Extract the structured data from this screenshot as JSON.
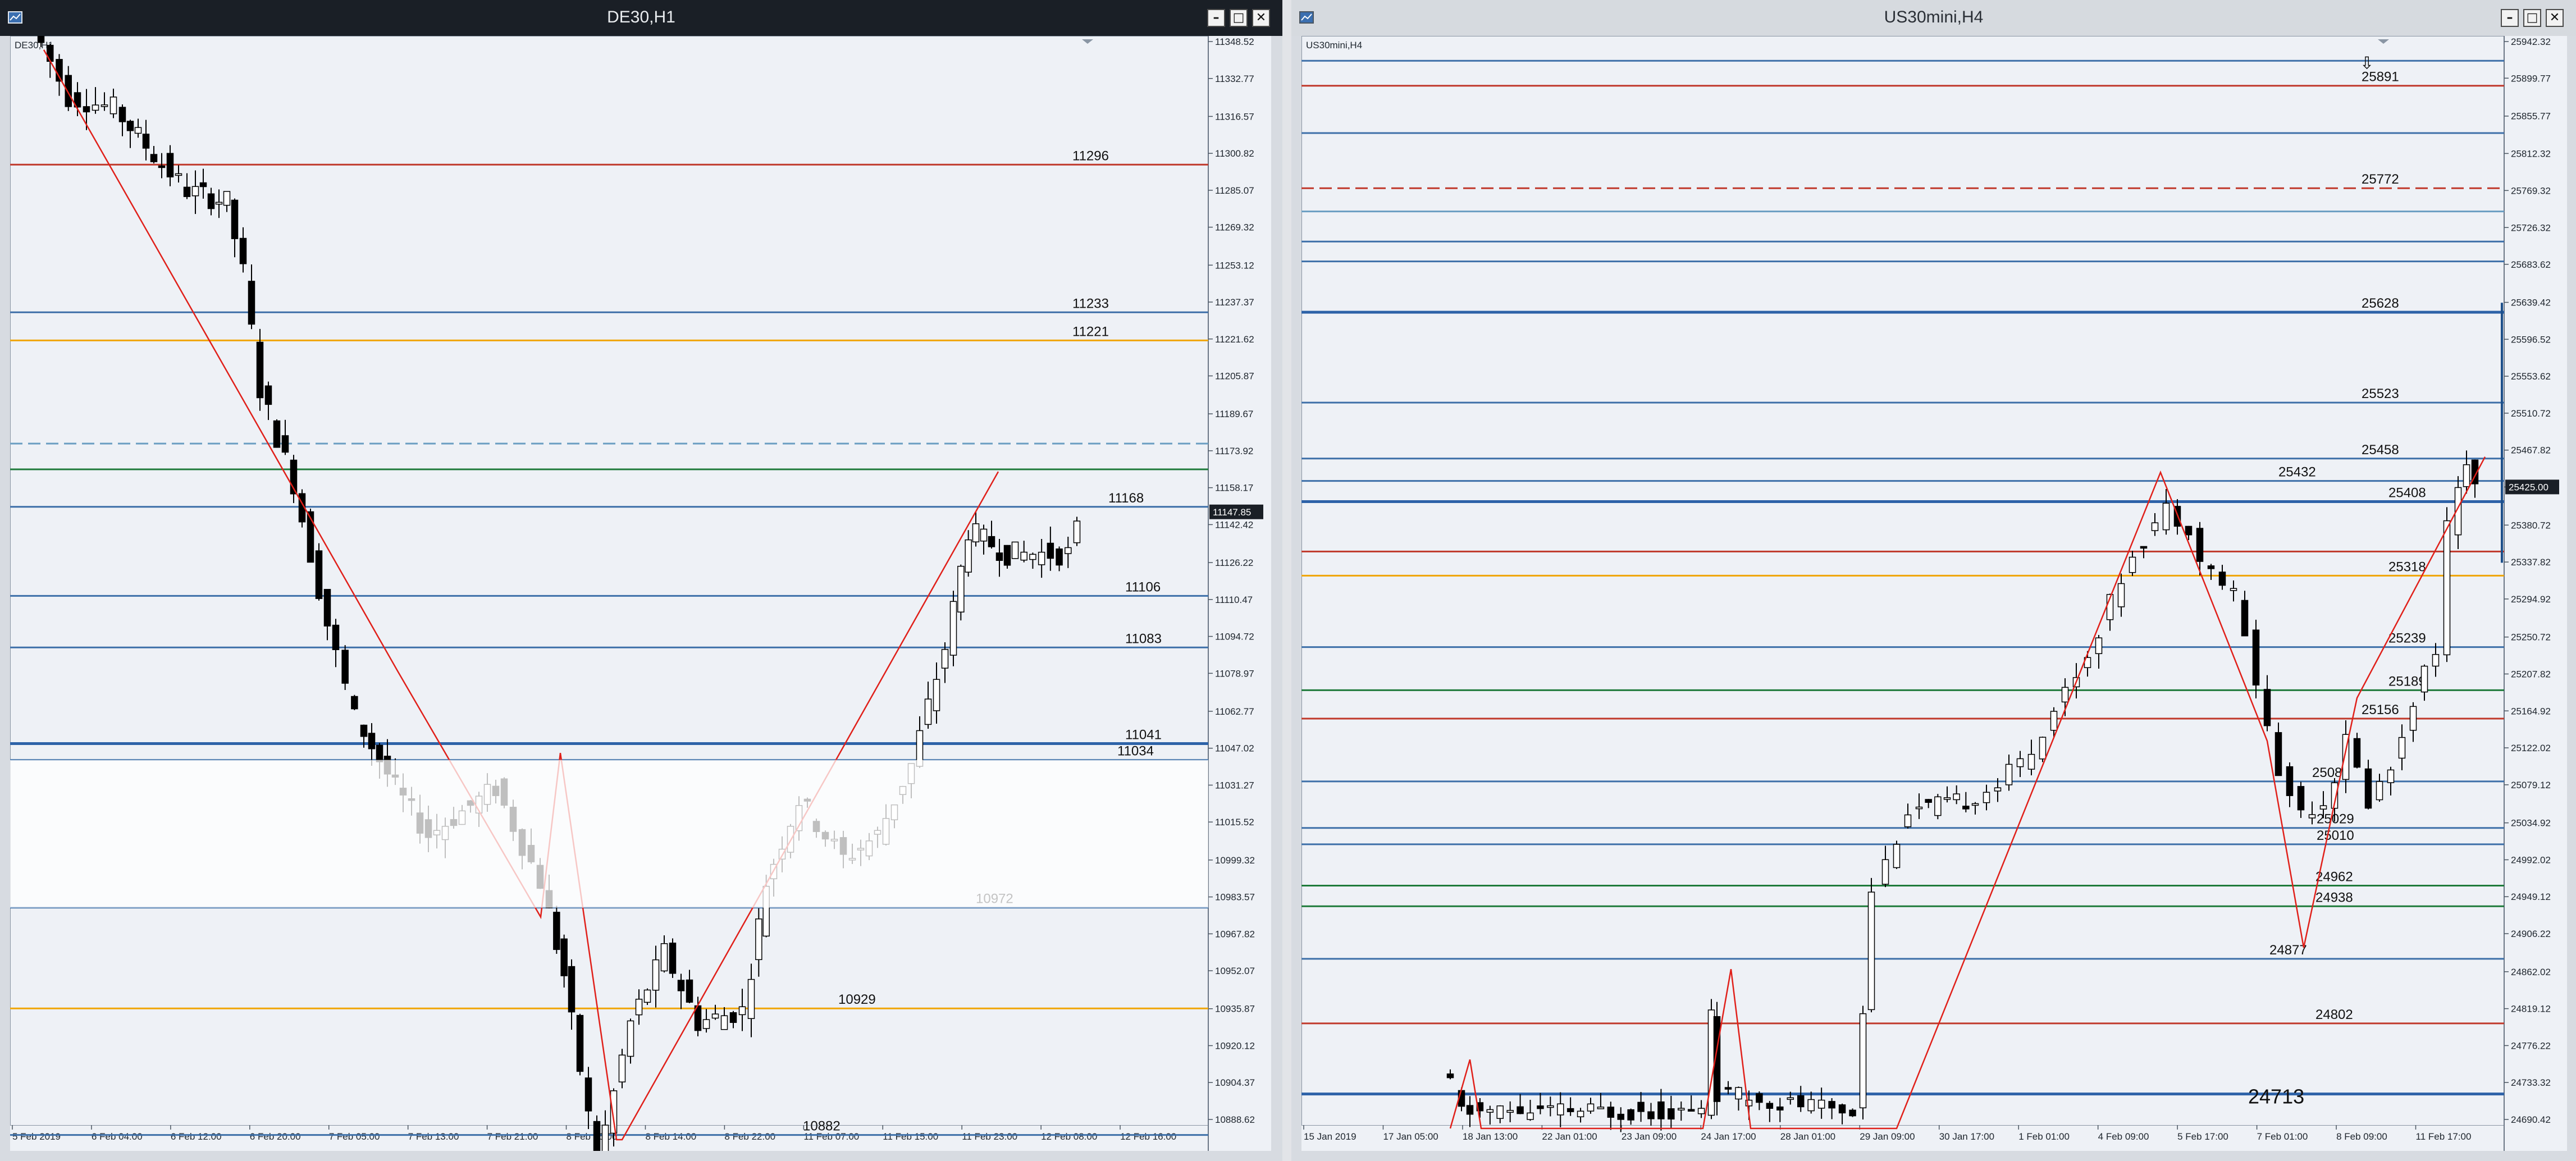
{
  "left_window": {
    "title": "DE30,H1",
    "symbol_label": "DE30,H1",
    "price_scale": [
      "11348.52",
      "11332.77",
      "11316.57",
      "11300.82",
      "11285.07",
      "11269.32",
      "11253.12",
      "11237.37",
      "11221.62",
      "11205.87",
      "11189.67",
      "11173.92",
      "11158.17",
      "11142.42",
      "11126.22",
      "11110.47",
      "11094.72",
      "11078.97",
      "11062.77",
      "11047.02",
      "11031.27",
      "11015.52",
      "10999.32",
      "10983.57",
      "10967.82",
      "10952.07",
      "10935.87",
      "10920.12",
      "10904.37",
      "10888.62"
    ],
    "current_price": "11147.85",
    "time_axis": [
      "5 Feb 2019",
      "6 Feb 04:00",
      "6 Feb 12:00",
      "6 Feb 20:00",
      "7 Feb 05:00",
      "7 Feb 13:00",
      "7 Feb 21:00",
      "8 Feb 06:00",
      "8 Feb 14:00",
      "8 Feb 22:00",
      "11 Feb 07:00",
      "11 Feb 15:00",
      "11 Feb 23:00",
      "12 Feb 08:00",
      "12 Feb 16:00"
    ],
    "levels": [
      {
        "label": "11296",
        "price": 11296,
        "color": "#c0392b"
      },
      {
        "label": "11233",
        "price": 11233,
        "color": "#3d6fa8"
      },
      {
        "label": "11221",
        "price": 11221,
        "color": "#f0a500"
      },
      {
        "label": "",
        "price": 11177,
        "color": "#6a9ec2",
        "style": "dashed"
      },
      {
        "label": "",
        "price": 11166,
        "color": "#1e7a3a"
      },
      {
        "label": "11168",
        "price": 11150,
        "color": "#3d6fa8"
      },
      {
        "label": "11106",
        "price": 11112,
        "color": "#3d6fa8"
      },
      {
        "label": "11083",
        "price": 11090,
        "color": "#3d6fa8"
      },
      {
        "label": "11041",
        "price": 11049,
        "color": "#2d62a8"
      },
      {
        "label": "11034",
        "price": 11042,
        "color": "#3d6fa8"
      },
      {
        "label": "10972",
        "price": 10979,
        "color": "#3d6fa8"
      },
      {
        "label": "10929",
        "price": 10936,
        "color": "#f0a500"
      },
      {
        "label": "10882",
        "price": 10882,
        "color": "#3d6fa8"
      }
    ]
  },
  "right_window": {
    "title": "US30mini,H4",
    "symbol_label": "US30mini,H4",
    "price_scale": [
      "25942.32",
      "25899.77",
      "25855.77",
      "25812.32",
      "25769.32",
      "25726.32",
      "25683.62",
      "25639.42",
      "25596.52",
      "25553.62",
      "25510.72",
      "25467.82",
      "25425.00",
      "25380.72",
      "25337.82",
      "25294.92",
      "25250.72",
      "25207.82",
      "25164.92",
      "25122.02",
      "25079.12",
      "25034.92",
      "24992.02",
      "24949.12",
      "24906.22",
      "24862.02",
      "24819.12",
      "24776.22",
      "24733.32",
      "24690.42"
    ],
    "current_price": "25425.00",
    "time_axis": [
      "15 Jan 2019",
      "17 Jan 05:00",
      "18 Jan 13:00",
      "22 Jan 01:00",
      "23 Jan 09:00",
      "24 Jan 17:00",
      "28 Jan 01:00",
      "29 Jan 09:00",
      "30 Jan 17:00",
      "1 Feb 01:00",
      "4 Feb 09:00",
      "5 Feb 17:00",
      "7 Feb 01:00",
      "8 Feb 09:00",
      "11 Feb 17:00"
    ],
    "arrow_glyph": "⇩",
    "big_label": "24713",
    "levels": [
      {
        "label": "",
        "price": 25920,
        "color": "#3d6fa8"
      },
      {
        "label": "25891",
        "price": 25891,
        "color": "#c0392b"
      },
      {
        "label": "",
        "price": 25836,
        "color": "#3d6fa8"
      },
      {
        "label": "25772",
        "price": 25772,
        "color": "#c0392b",
        "style": "dashed"
      },
      {
        "label": "",
        "price": 25745,
        "color": "#6a9ec2"
      },
      {
        "label": "",
        "price": 25710,
        "color": "#3d6fa8"
      },
      {
        "label": "",
        "price": 25687,
        "color": "#3d6fa8"
      },
      {
        "label": "25628",
        "price": 25628,
        "color": "#2d62a8"
      },
      {
        "label": "25523",
        "price": 25523,
        "color": "#3d6fa8"
      },
      {
        "label": "25458",
        "price": 25458,
        "color": "#3d6fa8"
      },
      {
        "label": "25432",
        "price": 25432,
        "color": "#3d6fa8"
      },
      {
        "label": "25408",
        "price": 25408,
        "color": "#2d62a8"
      },
      {
        "label": "",
        "price": 25350,
        "color": "#c0392b"
      },
      {
        "label": "25318",
        "price": 25322,
        "color": "#f0a500"
      },
      {
        "label": "25239",
        "price": 25239,
        "color": "#3d6fa8"
      },
      {
        "label": "25189",
        "price": 25189,
        "color": "#1e7a3a"
      },
      {
        "label": "25156",
        "price": 25156,
        "color": "#c0392b"
      },
      {
        "label": "25087",
        "price": 25083,
        "color": "#3d6fa8"
      },
      {
        "label": "25029",
        "price": 25029,
        "color": "#3d6fa8"
      },
      {
        "label": "25010",
        "price": 25010,
        "color": "#3d6fa8"
      },
      {
        "label": "24962",
        "price": 24962,
        "color": "#1e7a3a"
      },
      {
        "label": "24938",
        "price": 24938,
        "color": "#1e7a3a"
      },
      {
        "label": "24877",
        "price": 24877,
        "color": "#3d6fa8"
      },
      {
        "label": "24802",
        "price": 24802,
        "color": "#c0392b"
      },
      {
        "label": "",
        "price": 24720,
        "color": "#2d62a8"
      }
    ]
  }
}
